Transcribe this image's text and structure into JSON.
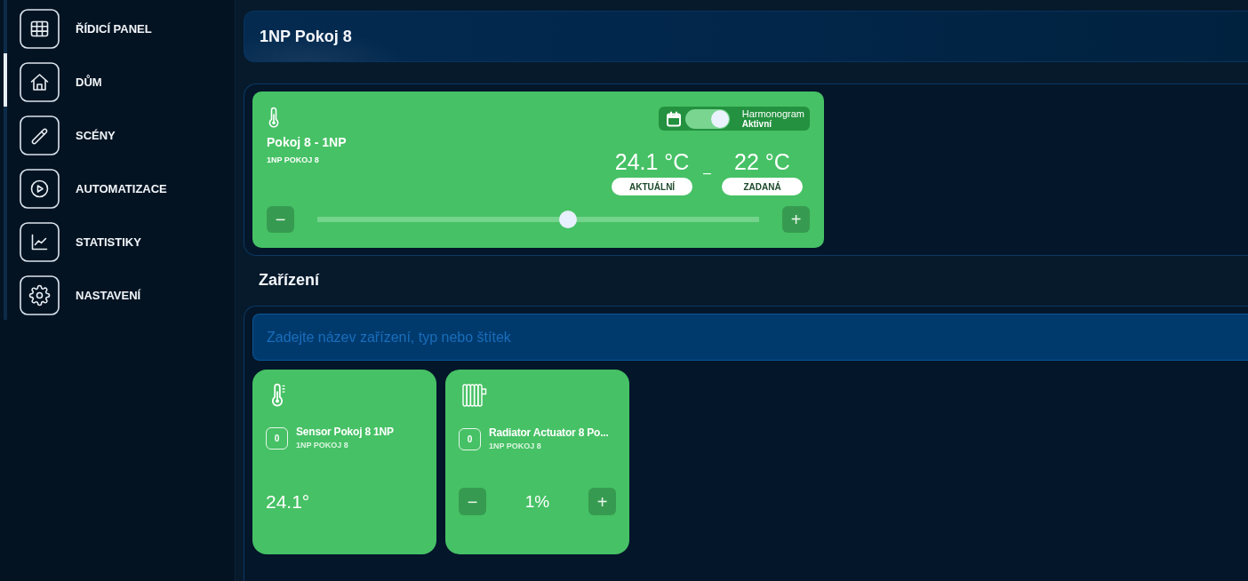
{
  "sidebar": {
    "items": [
      {
        "label": "ŘÍDICÍ PANEL",
        "selected": false
      },
      {
        "label": "DŮM",
        "selected": true
      },
      {
        "label": "SCÉNY",
        "selected": false
      },
      {
        "label": "AUTOMATIZACE",
        "selected": false
      },
      {
        "label": "STATISTIKY",
        "selected": false
      },
      {
        "label": "NASTAVENÍ",
        "selected": false
      }
    ]
  },
  "header": {
    "title": "1NP Pokoj 8"
  },
  "thermostat": {
    "name": "Pokoj 8 - 1NP",
    "room": "1NP POKOJ 8",
    "schedule": {
      "on": true,
      "label": "Harmonogram",
      "status": "Aktivní"
    },
    "current": {
      "value": "24.1 °C",
      "label": "AKTUÁLNÍ"
    },
    "separator": "–",
    "target": {
      "value": "22 °C",
      "label": "ZADANÁ"
    },
    "decrease": "−",
    "slider": {
      "level": 0.57
    },
    "increase": "+"
  },
  "devices_section": {
    "title": "Zařízení",
    "search": {
      "placeholder": "Zadejte název zařízení, typ nebo štítek"
    },
    "devices": [
      {
        "kind": "sensor",
        "badge": "0",
        "name": "Sensor Pokoj 8 1NP",
        "room": "1NP POKOJ 8",
        "value": "24.1°"
      },
      {
        "kind": "actuator",
        "badge": "0",
        "name": "Radiator Actuator 8 Po...",
        "room": "1NP POKOJ 8",
        "decrease": "−",
        "value": "1%",
        "increase": "+"
      }
    ]
  }
}
